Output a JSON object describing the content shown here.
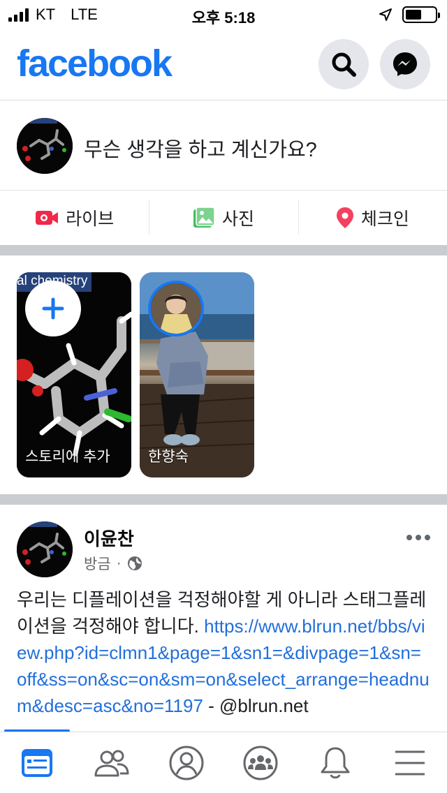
{
  "status_bar": {
    "carrier": "KT",
    "network": "LTE",
    "time": "오후 5:18"
  },
  "header": {
    "logo": "facebook",
    "search_icon": "search-icon",
    "messenger_icon": "messenger-icon"
  },
  "composer": {
    "prompt": "무슨 생각을 하고 계신가요?"
  },
  "actions": [
    {
      "label": "라이브",
      "icon": "live-video-icon",
      "color": "#f02849"
    },
    {
      "label": "사진",
      "icon": "photo-icon",
      "color": "#45bd62"
    },
    {
      "label": "체크인",
      "icon": "location-pin-icon",
      "color": "#f3425f"
    }
  ],
  "stories": {
    "add": {
      "label": "스토리에 추가",
      "tag": "al chemistry"
    },
    "friend": {
      "name": "한향숙"
    }
  },
  "post": {
    "author": "이윤찬",
    "time": "방금",
    "separator": "·",
    "text": "우리는 디플레이션을 걱정해야할 게 아니라 스태그플레이션을 걱정해야 합니다. ",
    "link": "https://www.blrun.net/bbs/view.php?id=clmn1&page=1&sn1=&divpage=1&sn=off&ss=on&sc=on&sm=on&select_arrange=headnum&desc=asc&no=1197",
    "suffix": " - @blrun.net"
  },
  "colors": {
    "brand": "#1877f2",
    "link": "#216fdb",
    "divider": "#c9ccd1"
  },
  "tabs": [
    "home-icon",
    "friends-icon",
    "profile-icon",
    "groups-icon",
    "notifications-icon",
    "menu-icon"
  ]
}
